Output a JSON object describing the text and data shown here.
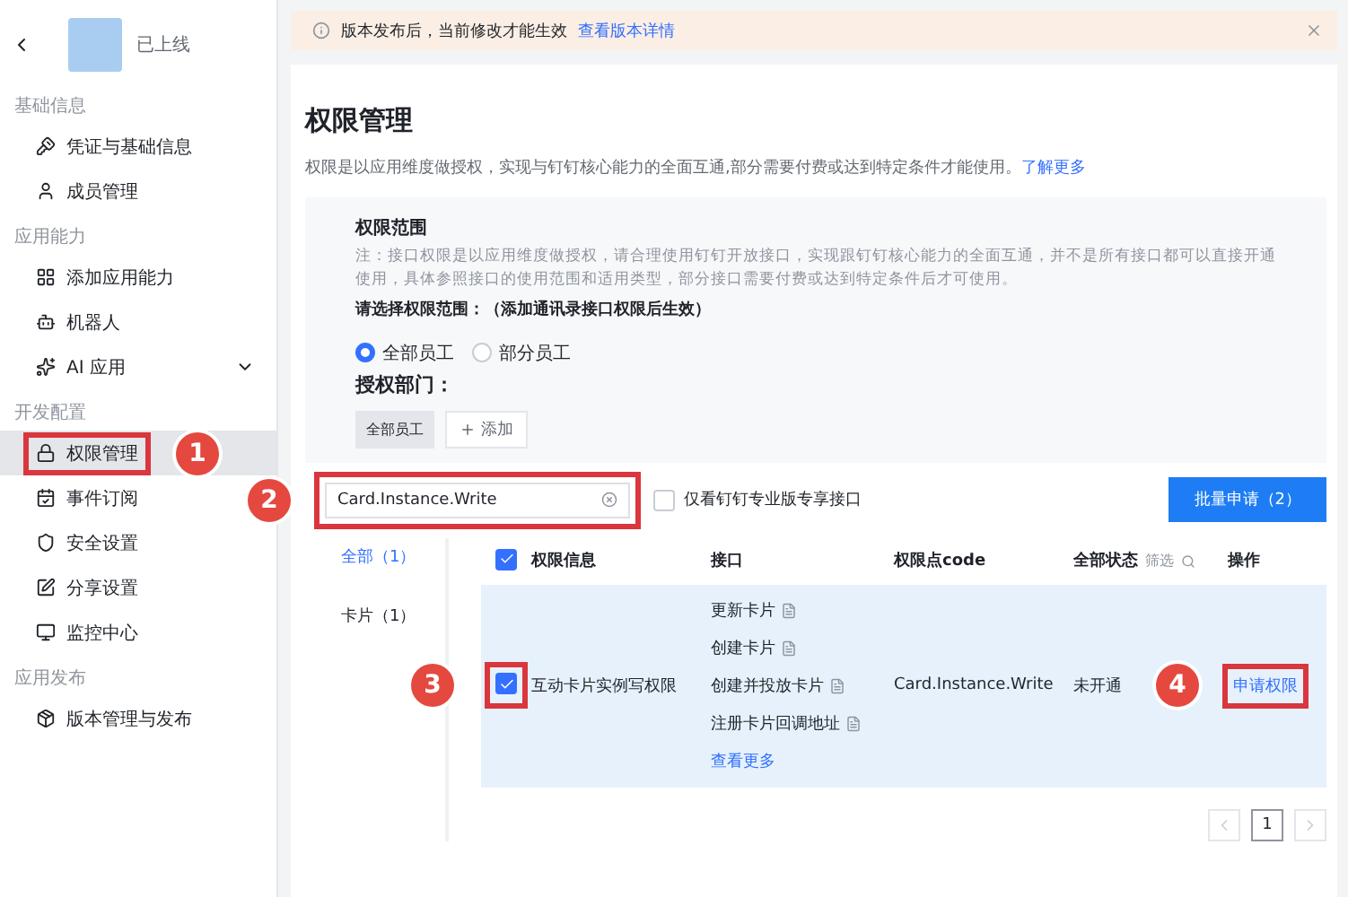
{
  "sidebar": {
    "app": {
      "status": "已上线"
    },
    "sections": [
      {
        "title": "基础信息",
        "items": [
          {
            "label": "凭证与基础信息",
            "selected": false
          },
          {
            "label": "成员管理",
            "selected": false
          }
        ]
      },
      {
        "title": "应用能力",
        "items": [
          {
            "label": "添加应用能力",
            "selected": false
          },
          {
            "label": "机器人",
            "selected": false
          },
          {
            "label": "AI 应用",
            "selected": false,
            "expanded": false
          }
        ]
      },
      {
        "title": "开发配置",
        "items": [
          {
            "label": "权限管理",
            "selected": true,
            "highlight": true,
            "callout": "1"
          },
          {
            "label": "事件订阅",
            "selected": false
          },
          {
            "label": "安全设置",
            "selected": false
          },
          {
            "label": "分享设置",
            "selected": false
          },
          {
            "label": "监控中心",
            "selected": false
          }
        ]
      },
      {
        "title": "应用发布",
        "items": [
          {
            "label": "版本管理与发布",
            "selected": false
          }
        ]
      }
    ]
  },
  "banner": {
    "text": "版本发布后，当前修改才能生效",
    "link": "查看版本详情"
  },
  "title": "权限管理",
  "description": {
    "text": "权限是以应用维度做授权，实现与钉钉核心能力的全面互通,部分需要付费或达到特定条件才能使用。",
    "link": "了解更多"
  },
  "scope": {
    "title": "权限范围",
    "note": "注：接口权限是以应用维度做授权，请合理使用钉钉开放接口，实现跟钉钉核心能力的全面互通，并不是所有接口都可以直接开通使用，具体参照接口的使用范围和适用类型，部分接口需要付费或达到特定条件后才可使用。",
    "prompt": "请选择权限范围：（添加通讯录接口权限后生效）",
    "radios": [
      {
        "label": "全部员工",
        "selected": true
      },
      {
        "label": "部分员工",
        "selected": false
      }
    ],
    "dept_label": "授权部门：",
    "dept_tags": [
      "全部员工"
    ],
    "add_button": "添加"
  },
  "search": {
    "value": "Card.Instance.Write",
    "highlight": true,
    "callout": "2"
  },
  "pro_only": {
    "label": "仅看钉钉专业版专享接口",
    "checked": false
  },
  "batch_button": "批量申请（2）",
  "categories": [
    {
      "label": "全部（1）",
      "selected": true
    },
    {
      "label": "卡片（1）",
      "selected": false
    }
  ],
  "table": {
    "all_checked": true,
    "columns": [
      "权限信息",
      "接口",
      "权限点code",
      "全部状态",
      "操作"
    ],
    "filter": "筛选",
    "rows": [
      {
        "checked": true,
        "highlight": true,
        "callout": "3",
        "name": "互动卡片实例写权限",
        "apis": [
          "更新卡片",
          "创建卡片",
          "创建并投放卡片",
          "注册卡片回调地址"
        ],
        "more": "查看更多",
        "code": "Card.Instance.Write",
        "status": "未开通",
        "action": "申请权限",
        "action_highlight": true,
        "action_callout": "4"
      }
    ]
  },
  "pagination": {
    "pages": [
      {
        "label": "1",
        "selected": true
      }
    ]
  }
}
